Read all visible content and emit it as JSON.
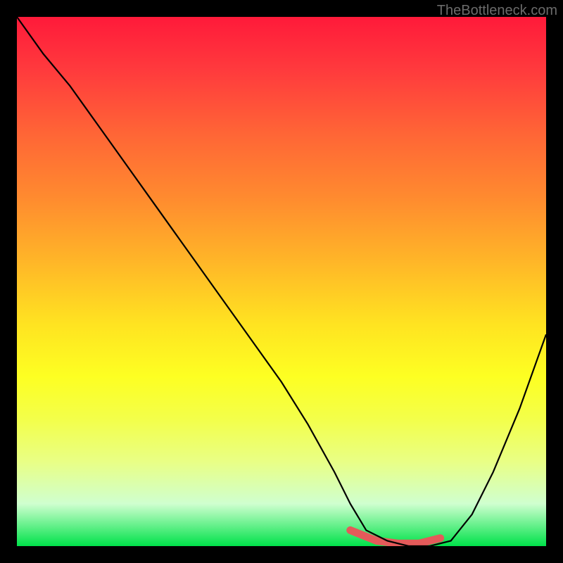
{
  "watermark": "TheBottleneck.com",
  "chart_data": {
    "type": "line",
    "title": "",
    "xlabel": "",
    "ylabel": "",
    "xlim": [
      0,
      100
    ],
    "ylim": [
      0,
      100
    ],
    "grid": false,
    "series": [
      {
        "name": "curve",
        "x": [
          0,
          5,
          10,
          15,
          20,
          25,
          30,
          35,
          40,
          45,
          50,
          55,
          60,
          63,
          66,
          70,
          74,
          78,
          82,
          86,
          90,
          95,
          100
        ],
        "y": [
          100,
          93,
          87,
          80,
          73,
          66,
          59,
          52,
          45,
          38,
          31,
          23,
          14,
          8,
          3,
          1,
          0,
          0,
          1,
          6,
          14,
          26,
          40
        ]
      }
    ],
    "accent_segment": {
      "name": "highlighted-minimum",
      "x": [
        63,
        68,
        72,
        76,
        80
      ],
      "y": [
        3,
        1,
        0.5,
        0.5,
        1.5
      ],
      "color": "#e45a5a"
    },
    "background_gradient": {
      "direction": "top-to-bottom",
      "stops": [
        {
          "pos": 0.0,
          "color": "#ff1a3a"
        },
        {
          "pos": 0.5,
          "color": "#ffcc25"
        },
        {
          "pos": 0.85,
          "color": "#eaff80"
        },
        {
          "pos": 1.0,
          "color": "#00e24a"
        }
      ]
    }
  }
}
